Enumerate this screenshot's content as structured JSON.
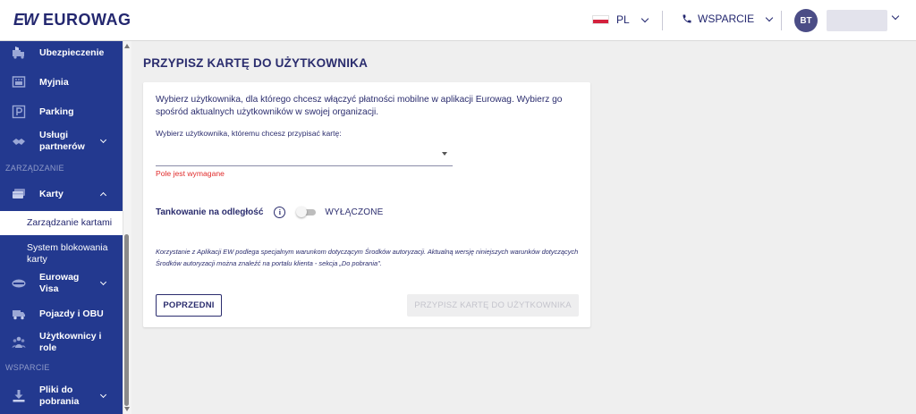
{
  "header": {
    "logo_mark": "EW",
    "logo_text": "EUROWAG",
    "language": "PL",
    "support_label": "WSPARCIE",
    "user_initials": "BT"
  },
  "sidebar": {
    "items": [
      {
        "label": "Ubezpieczenie",
        "icon": "truck-shield-icon"
      },
      {
        "label": "Myjnia",
        "icon": "car-wash-icon"
      },
      {
        "label": "Parking",
        "icon": "parking-icon"
      },
      {
        "label": "Usługi partnerów",
        "label_line1": "Usługi",
        "label_line2": "partnerów",
        "icon": "handshake-icon"
      },
      {
        "label": "Karty",
        "icon": "cards-icon"
      },
      {
        "label": "Eurowag Visa",
        "label_line1": "Eurowag",
        "label_line2": "Visa",
        "icon": "visa-card-icon"
      },
      {
        "label": "Pojazdy i OBU",
        "icon": "truck-icon"
      },
      {
        "label": "Użytkownicy i role",
        "label_line1": "Użytkownicy i",
        "label_line2": "role",
        "icon": "users-icon"
      },
      {
        "label": "Pliki do pobrania",
        "label_line1": "Pliki do",
        "label_line2": "pobrania",
        "icon": "download-icon"
      }
    ],
    "sections": {
      "management": "ZARZĄDZANIE",
      "support": "WSPARCIE"
    },
    "karty_sub": {
      "active": "Zarządzanie kartami",
      "other_line1": "System blokowania",
      "other_line2": "karty"
    }
  },
  "main": {
    "title": "PRZYPISZ KARTĘ DO UŻYTKOWNIKA",
    "intro": "Wybierz użytkownika, dla którego chcesz włączyć płatności mobilne w aplikacji Eurowag. Wybierz go spośród aktualnych użytkowników w swojej organizacji.",
    "select_label": "Wybierz użytkownika, któremu chcesz przypisać kartę:",
    "select_value": "",
    "error": "Pole jest wymagane",
    "remote_fueling_label": "Tankowanie na odległość",
    "remote_fueling_state": "WYŁĄCZONE",
    "remote_fueling_enabled": false,
    "disclaimer": "Korzystanie z Aplikacji EW podlega specjalnym warunkom dotyczącym Środków autoryzacji. Aktualną wersję niniejszych warunków dotyczących Środków autoryzacji można znaleźć na portalu klienta - sekcja „Do pobrania\".",
    "prev_button": "POPRZEDNI",
    "assign_button": "PRZYPISZ KARTĘ DO UŻYTKOWNIKA"
  },
  "colors": {
    "sidebar_bg": "#23398f",
    "brand": "#23276f",
    "error": "#e02b2b"
  }
}
